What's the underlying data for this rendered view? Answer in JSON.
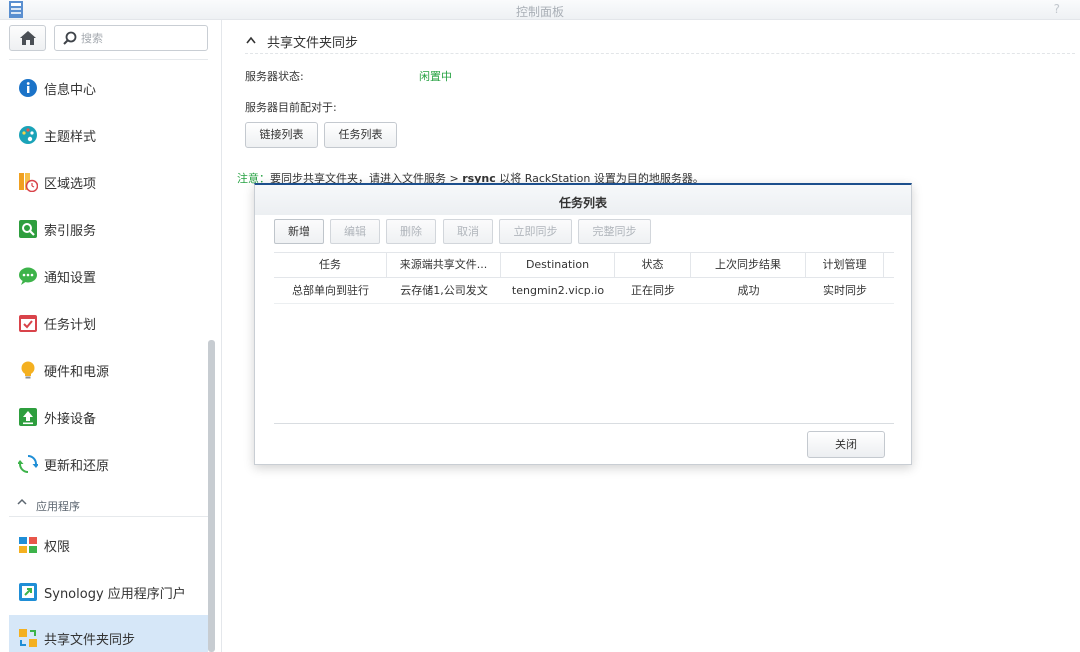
{
  "window": {
    "title": "控制面板",
    "help_icon": "?"
  },
  "sidebar": {
    "home_icon": "home-icon",
    "search_placeholder": "搜索",
    "items": [
      {
        "label": "信息中心",
        "icon": "info-icon",
        "color": "#1b73c8"
      },
      {
        "label": "主题样式",
        "icon": "palette-icon",
        "color": "#1aa3b8"
      },
      {
        "label": "区域选项",
        "icon": "region-clock-icon",
        "color": "#f0a020"
      },
      {
        "label": "索引服务",
        "icon": "index-search-icon",
        "color": "#2e9e3e"
      },
      {
        "label": "通知设置",
        "icon": "chat-bubble-icon",
        "color": "#3db34a"
      },
      {
        "label": "任务计划",
        "icon": "calendar-check-icon",
        "color": "#d9434a"
      },
      {
        "label": "硬件和电源",
        "icon": "lightbulb-icon",
        "color": "#f4b020"
      },
      {
        "label": "外接设备",
        "icon": "upload-device-icon",
        "color": "#2e9e3e"
      },
      {
        "label": "更新和还原",
        "icon": "refresh-icon",
        "color": "#1f8ed6"
      }
    ],
    "section": {
      "label": "应用程序"
    },
    "app_items": [
      {
        "label": "权限",
        "icon": "permission-blocks-icon"
      },
      {
        "label": "Synology 应用程序门户",
        "icon": "app-portal-icon"
      },
      {
        "label": "共享文件夹同步",
        "icon": "shared-folder-sync-icon",
        "active": true
      }
    ]
  },
  "main": {
    "section_title": "共享文件夹同步",
    "server_status_label": "服务器状态:",
    "server_status_value": "闲置中",
    "paired_label": "服务器目前配对于:",
    "buttons": {
      "link_list": "链接列表",
      "task_list": "任务列表"
    },
    "note": {
      "label": "注意：",
      "text_before": "要同步共享文件夹，请进入文件服务 > ",
      "bold": "rsync",
      "text_after": " 以将 RackStation 设置为目的地服务器。"
    }
  },
  "dialog": {
    "title": "任务列表",
    "toolbar": [
      {
        "label": "新增",
        "enabled": true
      },
      {
        "label": "编辑",
        "enabled": false
      },
      {
        "label": "删除",
        "enabled": false
      },
      {
        "label": "取消",
        "enabled": false
      },
      {
        "label": "立即同步",
        "enabled": false
      },
      {
        "label": "完整同步",
        "enabled": false
      }
    ],
    "columns": [
      "任务",
      "来源端共享文件...",
      "Destination",
      "状态",
      "上次同步结果",
      "计划管理"
    ],
    "rows": [
      [
        "总部单向到驻行",
        "云存储1,公司发文",
        "tengmin2.vicp.io",
        "正在同步",
        "成功",
        "实时同步"
      ]
    ],
    "close_label": "关闭"
  }
}
